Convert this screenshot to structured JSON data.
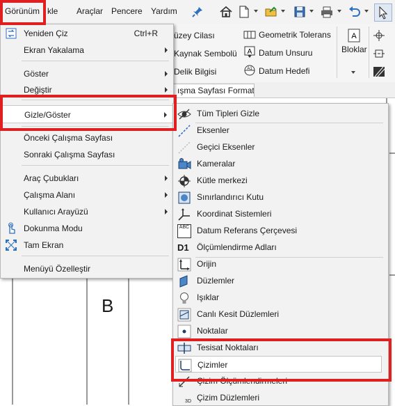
{
  "menubar": {
    "items": [
      "Görünüm",
      "kle",
      "Araçlar",
      "Pencere",
      "Yardım"
    ],
    "pin_icon": "pin-icon",
    "toolbar_icons": [
      "home-icon",
      "new-document-icon",
      "open-icon",
      "save-icon",
      "print-icon",
      "undo-icon",
      "select-icon"
    ]
  },
  "ribbon": {
    "col1": [
      "üzey Cilası",
      "Kaynak Sembolü",
      "Delik Bilgisi"
    ],
    "col2": [
      "Geometrik Tolerans",
      "Datum Unsuru",
      "Datum Hedefi"
    ],
    "bloklar": "Bloklar"
  },
  "tab": {
    "label": "Çalışma Sayfası Formatı",
    "visible_label": "ışma Sayfası Formatı"
  },
  "drawing": {
    "letter": "B"
  },
  "main_menu": {
    "items": [
      {
        "label": "Yeniden Çiz",
        "shortcut": "Ctrl+R",
        "icon": "redraw-icon"
      },
      {
        "label": "Ekran Yakalama",
        "submenu": true
      },
      {
        "label": "Göster",
        "submenu": true
      },
      {
        "label": "Değiştir",
        "submenu": true
      },
      {
        "label": "Gizle/Göster",
        "submenu": true,
        "highlighted": true
      },
      {
        "label": "Önceki Çalışma Sayfası"
      },
      {
        "label": "Sonraki Çalışma Sayfası"
      },
      {
        "label": "Araç Çubukları",
        "submenu": true
      },
      {
        "label": "Çalışma Alanı",
        "submenu": true
      },
      {
        "label": "Kullanıcı Arayüzü",
        "submenu": true
      },
      {
        "label": "Dokunma Modu",
        "icon": "touch-icon"
      },
      {
        "label": "Tam Ekran",
        "icon": "fullscreen-icon"
      },
      {
        "label": "Menüyü Özelleştir"
      }
    ]
  },
  "sub_menu": {
    "items": [
      {
        "label": "Tüm Tipleri Gizle",
        "icon": "eye-icon"
      },
      {
        "label": "Eksenler",
        "icon": "axis-icon"
      },
      {
        "label": "Geçici Eksenler",
        "icon": "temporary-axis-icon"
      },
      {
        "label": "Kameralar",
        "icon": "camera-icon"
      },
      {
        "label": "Kütle merkezi",
        "icon": "center-of-mass-icon"
      },
      {
        "label": "Sınırlandırıcı Kutu",
        "icon": "bounding-box-icon"
      },
      {
        "label": "Koordinat Sistemleri",
        "icon": "coordinate-system-icon"
      },
      {
        "label": "Datum Referans Çerçevesi",
        "icon": "datum-frame-icon",
        "icon_text": "ABC"
      },
      {
        "label": "Ölçümlendirme Adları",
        "icon": "dimension-names-icon",
        "icon_text": "D1"
      },
      {
        "label": "Orijin",
        "icon": "origin-icon"
      },
      {
        "label": "Düzlemler",
        "icon": "plane-icon"
      },
      {
        "label": "Işıklar",
        "icon": "light-bulb-icon"
      },
      {
        "label": "Canlı Kesit Düzlemleri",
        "icon": "live-section-icon"
      },
      {
        "label": "Noktalar",
        "icon": "point-icon"
      },
      {
        "label": "Tesisat Noktaları",
        "icon": "routing-point-icon"
      },
      {
        "label": "Çizimler",
        "icon": "sketch-icon",
        "highlighted": true
      },
      {
        "label": "Çizim Ölçümlendirmeleri",
        "icon": "sketch-dimension-icon"
      },
      {
        "label": "Çizim Düzlemleri",
        "icon": "sketch-plane-icon",
        "icon_text": "3D"
      }
    ]
  },
  "colors": {
    "highlight_box": "#e02020",
    "menu_bg": "#f2f2f2"
  }
}
